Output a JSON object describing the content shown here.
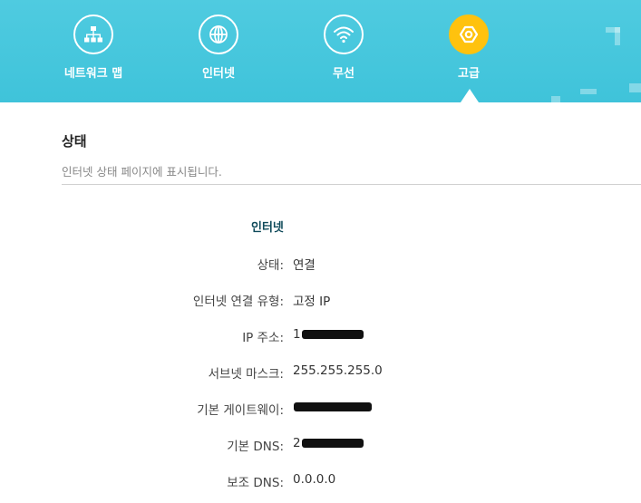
{
  "nav": {
    "items": [
      {
        "label": "네트워크 맵",
        "icon": "network-map-icon"
      },
      {
        "label": "인터넷",
        "icon": "globe-icon"
      },
      {
        "label": "무선",
        "icon": "wifi-icon"
      },
      {
        "label": "고급",
        "icon": "gear-icon"
      }
    ],
    "active": "고급"
  },
  "colors": {
    "header": "#46c7de",
    "active_accent": "#ffc20e",
    "group_title": "#0f4a5a"
  },
  "section": {
    "title": "상태",
    "description": "인터넷 상태 페이지에 표시됩니다."
  },
  "internet": {
    "title": "인터넷",
    "rows": [
      {
        "label": "상태:",
        "value": "연결"
      },
      {
        "label": "인터넷 연결 유형:",
        "value": "고정 IP"
      },
      {
        "label": "IP 주소:",
        "value": "1",
        "redacted": true
      },
      {
        "label": "서브넷 마스크:",
        "value": "255.255.255.0"
      },
      {
        "label": "기본 게이트웨이:",
        "value": "",
        "redacted": true
      },
      {
        "label": "기본 DNS:",
        "value": "2",
        "redacted": true
      },
      {
        "label": "보조 DNS:",
        "value": "0.0.0.0"
      }
    ]
  }
}
